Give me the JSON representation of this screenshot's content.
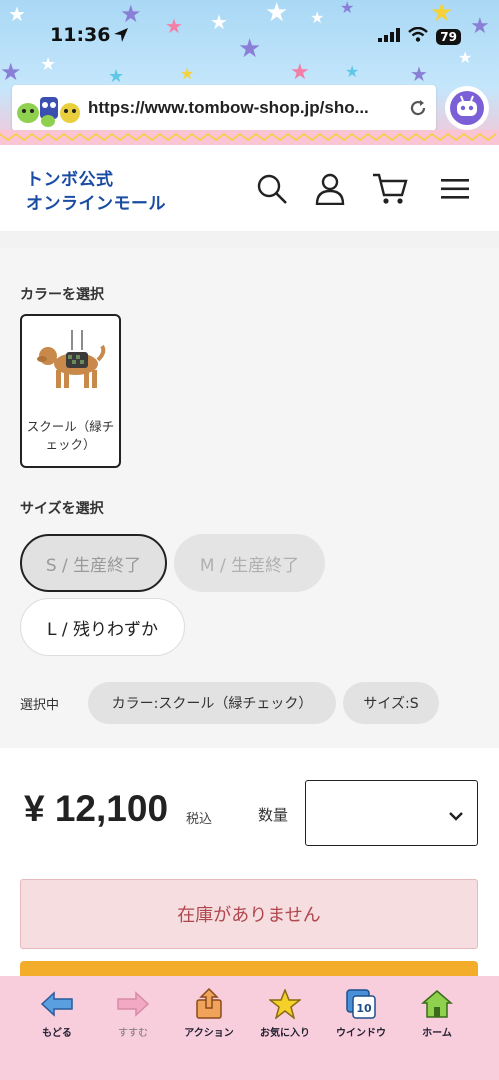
{
  "status_bar": {
    "time": "11:36",
    "battery": "79"
  },
  "browser": {
    "url": "https://www.tombow-shop.jp/sho..."
  },
  "site": {
    "logo_line1": "トンボ公式",
    "logo_line2": "オンラインモール"
  },
  "color_section": {
    "label": "カラーを選択",
    "options": [
      {
        "caption": "スクール（緑チェック）",
        "selected": true
      }
    ]
  },
  "size_section": {
    "label": "サイズを選択",
    "options": [
      {
        "label": "S / 生産終了",
        "state": "selected-disabled"
      },
      {
        "label": "M / 生産終了",
        "state": "disabled"
      },
      {
        "label": "L / 残りわずか",
        "state": "available"
      }
    ]
  },
  "selection": {
    "label": "選択中",
    "chips": [
      "カラー:スクール（緑チェック）",
      "サイズ:S"
    ]
  },
  "purchase": {
    "price": "¥ 12,100",
    "tax_label": "税込",
    "quantity_label": "数量",
    "quantity_value": "",
    "stock_status": "在庫がありません"
  },
  "toolbar": {
    "items": [
      {
        "label": "もどる",
        "icon": "back-arrow-icon"
      },
      {
        "label": "すすむ",
        "icon": "forward-arrow-icon"
      },
      {
        "label": "アクション",
        "icon": "share-icon"
      },
      {
        "label": "お気に入り",
        "icon": "star-icon"
      },
      {
        "label": "ウインドウ",
        "icon": "windows-icon",
        "badge": "10"
      },
      {
        "label": "ホーム",
        "icon": "home-icon"
      }
    ]
  },
  "colors": {
    "brand_blue": "#1a4ca4",
    "stock_text": "#b0474f",
    "stock_bg": "#f5dde0",
    "cta_orange": "#f3ad2b",
    "toolbar_pink": "#f9cedc"
  }
}
